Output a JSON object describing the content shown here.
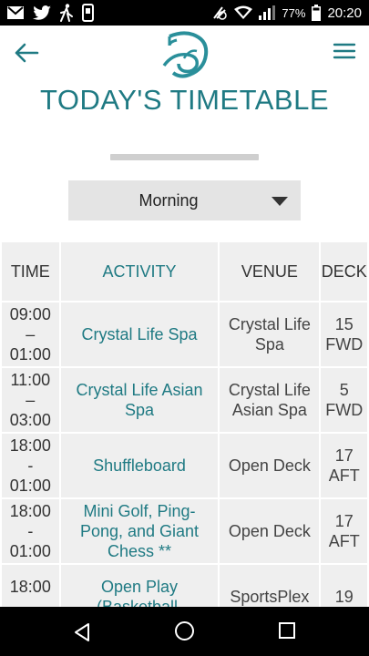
{
  "status_bar": {
    "battery": "77%",
    "time": "20:20",
    "left_icons": [
      "mail-icon",
      "twitter-icon",
      "walking-icon",
      "phone-notification-icon"
    ],
    "right_icons": [
      "nfc-icon",
      "wifi-icon",
      "signal-icon",
      "battery-icon"
    ]
  },
  "header": {
    "back_icon": "arrow-left-icon",
    "menu_icon": "hamburger-menu-icon",
    "logo_icon": "crystal-logo-icon"
  },
  "page": {
    "title": "TODAY'S TIMETABLE"
  },
  "filter": {
    "selected": "Morning"
  },
  "table": {
    "headers": {
      "time": "TIME",
      "activity": "ACTIVITY",
      "venue": "VENUE",
      "deck": "DECK"
    },
    "rows": [
      {
        "time": [
          "09:00",
          "–",
          "01:00"
        ],
        "activity": [
          "Crystal Life Spa"
        ],
        "venue": [
          "Crystal Life",
          "Spa"
        ],
        "deck": [
          "15",
          "FWD"
        ]
      },
      {
        "time": [
          "11:00",
          "–",
          "03:00"
        ],
        "activity": [
          "Crystal Life Asian",
          "Spa"
        ],
        "venue": [
          "Crystal Life",
          "Asian Spa"
        ],
        "deck": [
          "5",
          "FWD"
        ]
      },
      {
        "time": [
          "18:00",
          "-",
          "01:00"
        ],
        "activity": [
          "Shuffleboard"
        ],
        "venue": [
          "Open Deck"
        ],
        "deck": [
          "17",
          "AFT"
        ]
      },
      {
        "time": [
          "18:00",
          "-",
          "01:00"
        ],
        "activity": [
          "Mini Golf, Ping-",
          "Pong, and Giant",
          "Chess **"
        ],
        "venue": [
          "Open Deck"
        ],
        "deck": [
          "17",
          "AFT"
        ]
      },
      {
        "time": [
          "18:00",
          "-",
          ""
        ],
        "activity": [
          "Open Play",
          "(Basketball,",
          ""
        ],
        "venue": [
          "SportsPlex"
        ],
        "deck": [
          "19",
          ""
        ]
      }
    ]
  },
  "colors": {
    "accent": "#1f7a83",
    "cell_bg": "#efefef",
    "select_bg": "#e4e4e4"
  },
  "nav_bar": {
    "back_icon": "nav-back-icon",
    "home_icon": "nav-home-icon",
    "recents_icon": "nav-recents-icon"
  }
}
